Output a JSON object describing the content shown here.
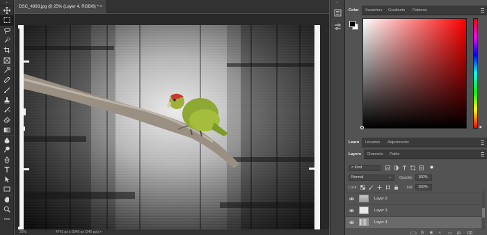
{
  "document": {
    "tab_title": "DSC_4993.jpg @ 25% (Layer 4, RGB/8) *",
    "close_glyph": "×"
  },
  "status": {
    "zoom": "25%",
    "dimensions": "4741 px x 3049 px (240 ppi)",
    "arrow": ">"
  },
  "tools": [
    "move-tool",
    "marquee-tool",
    "lasso-tool",
    "quick-select-tool",
    "crop-tool",
    "frame-tool",
    "eyedropper-tool",
    "healing-tool",
    "brush-tool",
    "stamp-tool",
    "history-brush-tool",
    "eraser-tool",
    "gradient-tool",
    "blur-tool",
    "dodge-tool",
    "pen-tool",
    "type-tool",
    "path-select-tool",
    "rectangle-tool",
    "hand-tool",
    "zoom-tool",
    "more-tools"
  ],
  "color_panel": {
    "tabs": [
      "Color",
      "Swatches",
      "Gradients",
      "Patterns"
    ],
    "active_tab": "Color",
    "foreground": "#000000",
    "background": "#ffffff",
    "hue_color": "#ff0000"
  },
  "learn_panel": {
    "tabs": [
      "Learn",
      "Libraries",
      "Adjustments"
    ],
    "active_tab": "Learn"
  },
  "layers_panel": {
    "tabs": [
      "Layers",
      "Channels",
      "Paths"
    ],
    "active_tab": "Layers",
    "filter_kind": "Kind",
    "blend_mode": "Normal",
    "opacity_label": "Opacity:",
    "opacity_value": "100%",
    "lock_label": "Lock:",
    "fill_label": "Fill:",
    "fill_value": "100%",
    "layers": [
      {
        "name": "Layer 2",
        "selected": false
      },
      {
        "name": "Layer 3",
        "selected": false
      },
      {
        "name": "Layer 4",
        "selected": true
      }
    ]
  },
  "colors": {
    "app_bg": "#535353",
    "dark_bar": "#323232",
    "canvas_bg": "#282828"
  }
}
